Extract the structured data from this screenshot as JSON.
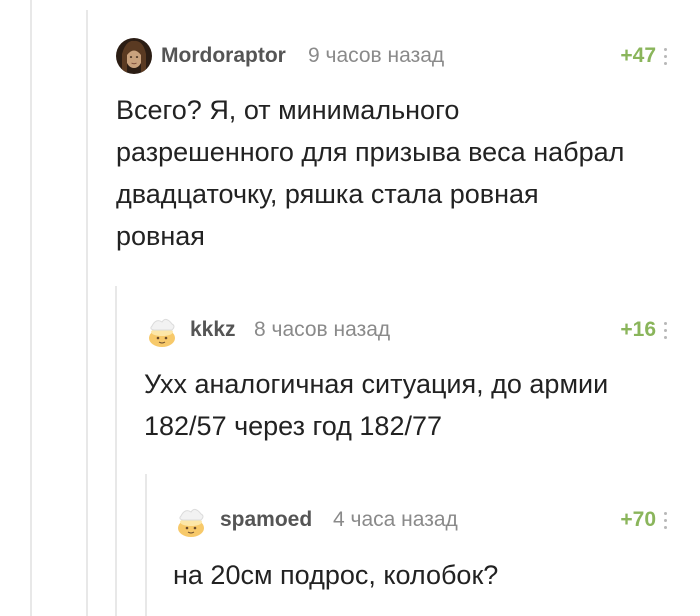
{
  "comments": [
    {
      "author": "Mordoraptor",
      "time": "9 часов назад",
      "rating": "+47",
      "avatar_icon": "user-photo-avatar",
      "lines": [
        "Всего? Я, от минимального",
        "разрешенного для призыва веса набрал",
        "двадцаточку, ряшка стала ровная",
        "ровная"
      ]
    },
    {
      "author": "kkkz",
      "time": "8 часов назад",
      "rating": "+16",
      "avatar_icon": "default-cake-avatar",
      "lines": [
        "Ухх аналогичная ситуация, до армии",
        "182/57 через год 182/77"
      ]
    },
    {
      "author": "spamoed",
      "time": "4 часа назад",
      "rating": "+70",
      "avatar_icon": "default-cake-avatar",
      "lines": [
        "на 20см подрос, колобок?"
      ]
    }
  ],
  "colors": {
    "rating": "#8ab55b",
    "author": "#555555",
    "time": "#8a8a8a",
    "thread_line": "#e8e8e8"
  }
}
